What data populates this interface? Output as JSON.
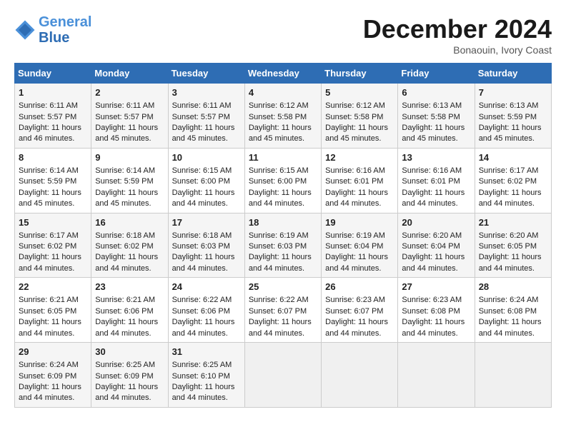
{
  "header": {
    "logo_line1": "General",
    "logo_line2": "Blue",
    "month_title": "December 2024",
    "location": "Bonaouin, Ivory Coast"
  },
  "days_of_week": [
    "Sunday",
    "Monday",
    "Tuesday",
    "Wednesday",
    "Thursday",
    "Friday",
    "Saturday"
  ],
  "weeks": [
    [
      {
        "day": "1",
        "lines": [
          "Sunrise: 6:11 AM",
          "Sunset: 5:57 PM",
          "Daylight: 11 hours",
          "and 46 minutes."
        ]
      },
      {
        "day": "2",
        "lines": [
          "Sunrise: 6:11 AM",
          "Sunset: 5:57 PM",
          "Daylight: 11 hours",
          "and 45 minutes."
        ]
      },
      {
        "day": "3",
        "lines": [
          "Sunrise: 6:11 AM",
          "Sunset: 5:57 PM",
          "Daylight: 11 hours",
          "and 45 minutes."
        ]
      },
      {
        "day": "4",
        "lines": [
          "Sunrise: 6:12 AM",
          "Sunset: 5:58 PM",
          "Daylight: 11 hours",
          "and 45 minutes."
        ]
      },
      {
        "day": "5",
        "lines": [
          "Sunrise: 6:12 AM",
          "Sunset: 5:58 PM",
          "Daylight: 11 hours",
          "and 45 minutes."
        ]
      },
      {
        "day": "6",
        "lines": [
          "Sunrise: 6:13 AM",
          "Sunset: 5:58 PM",
          "Daylight: 11 hours",
          "and 45 minutes."
        ]
      },
      {
        "day": "7",
        "lines": [
          "Sunrise: 6:13 AM",
          "Sunset: 5:59 PM",
          "Daylight: 11 hours",
          "and 45 minutes."
        ]
      }
    ],
    [
      {
        "day": "8",
        "lines": [
          "Sunrise: 6:14 AM",
          "Sunset: 5:59 PM",
          "Daylight: 11 hours",
          "and 45 minutes."
        ]
      },
      {
        "day": "9",
        "lines": [
          "Sunrise: 6:14 AM",
          "Sunset: 5:59 PM",
          "Daylight: 11 hours",
          "and 45 minutes."
        ]
      },
      {
        "day": "10",
        "lines": [
          "Sunrise: 6:15 AM",
          "Sunset: 6:00 PM",
          "Daylight: 11 hours",
          "and 44 minutes."
        ]
      },
      {
        "day": "11",
        "lines": [
          "Sunrise: 6:15 AM",
          "Sunset: 6:00 PM",
          "Daylight: 11 hours",
          "and 44 minutes."
        ]
      },
      {
        "day": "12",
        "lines": [
          "Sunrise: 6:16 AM",
          "Sunset: 6:01 PM",
          "Daylight: 11 hours",
          "and 44 minutes."
        ]
      },
      {
        "day": "13",
        "lines": [
          "Sunrise: 6:16 AM",
          "Sunset: 6:01 PM",
          "Daylight: 11 hours",
          "and 44 minutes."
        ]
      },
      {
        "day": "14",
        "lines": [
          "Sunrise: 6:17 AM",
          "Sunset: 6:02 PM",
          "Daylight: 11 hours",
          "and 44 minutes."
        ]
      }
    ],
    [
      {
        "day": "15",
        "lines": [
          "Sunrise: 6:17 AM",
          "Sunset: 6:02 PM",
          "Daylight: 11 hours",
          "and 44 minutes."
        ]
      },
      {
        "day": "16",
        "lines": [
          "Sunrise: 6:18 AM",
          "Sunset: 6:02 PM",
          "Daylight: 11 hours",
          "and 44 minutes."
        ]
      },
      {
        "day": "17",
        "lines": [
          "Sunrise: 6:18 AM",
          "Sunset: 6:03 PM",
          "Daylight: 11 hours",
          "and 44 minutes."
        ]
      },
      {
        "day": "18",
        "lines": [
          "Sunrise: 6:19 AM",
          "Sunset: 6:03 PM",
          "Daylight: 11 hours",
          "and 44 minutes."
        ]
      },
      {
        "day": "19",
        "lines": [
          "Sunrise: 6:19 AM",
          "Sunset: 6:04 PM",
          "Daylight: 11 hours",
          "and 44 minutes."
        ]
      },
      {
        "day": "20",
        "lines": [
          "Sunrise: 6:20 AM",
          "Sunset: 6:04 PM",
          "Daylight: 11 hours",
          "and 44 minutes."
        ]
      },
      {
        "day": "21",
        "lines": [
          "Sunrise: 6:20 AM",
          "Sunset: 6:05 PM",
          "Daylight: 11 hours",
          "and 44 minutes."
        ]
      }
    ],
    [
      {
        "day": "22",
        "lines": [
          "Sunrise: 6:21 AM",
          "Sunset: 6:05 PM",
          "Daylight: 11 hours",
          "and 44 minutes."
        ]
      },
      {
        "day": "23",
        "lines": [
          "Sunrise: 6:21 AM",
          "Sunset: 6:06 PM",
          "Daylight: 11 hours",
          "and 44 minutes."
        ]
      },
      {
        "day": "24",
        "lines": [
          "Sunrise: 6:22 AM",
          "Sunset: 6:06 PM",
          "Daylight: 11 hours",
          "and 44 minutes."
        ]
      },
      {
        "day": "25",
        "lines": [
          "Sunrise: 6:22 AM",
          "Sunset: 6:07 PM",
          "Daylight: 11 hours",
          "and 44 minutes."
        ]
      },
      {
        "day": "26",
        "lines": [
          "Sunrise: 6:23 AM",
          "Sunset: 6:07 PM",
          "Daylight: 11 hours",
          "and 44 minutes."
        ]
      },
      {
        "day": "27",
        "lines": [
          "Sunrise: 6:23 AM",
          "Sunset: 6:08 PM",
          "Daylight: 11 hours",
          "and 44 minutes."
        ]
      },
      {
        "day": "28",
        "lines": [
          "Sunrise: 6:24 AM",
          "Sunset: 6:08 PM",
          "Daylight: 11 hours",
          "and 44 minutes."
        ]
      }
    ],
    [
      {
        "day": "29",
        "lines": [
          "Sunrise: 6:24 AM",
          "Sunset: 6:09 PM",
          "Daylight: 11 hours",
          "and 44 minutes."
        ]
      },
      {
        "day": "30",
        "lines": [
          "Sunrise: 6:25 AM",
          "Sunset: 6:09 PM",
          "Daylight: 11 hours",
          "and 44 minutes."
        ]
      },
      {
        "day": "31",
        "lines": [
          "Sunrise: 6:25 AM",
          "Sunset: 6:10 PM",
          "Daylight: 11 hours",
          "and 44 minutes."
        ]
      },
      null,
      null,
      null,
      null
    ]
  ]
}
